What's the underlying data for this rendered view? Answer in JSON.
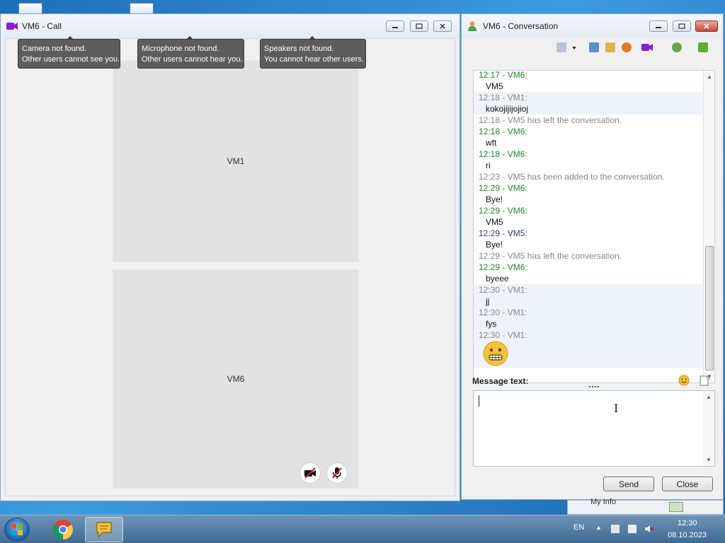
{
  "call_window": {
    "title": "VM6 - Call",
    "tooltips": [
      {
        "line1": "Camera not found.",
        "line2": "Other users cannot see you."
      },
      {
        "line1": "Microphone not found.",
        "line2": "Other users cannot hear you."
      },
      {
        "line1": "Speakers not found.",
        "line2": "You cannot hear other users."
      }
    ],
    "video_remote_label": "VM1",
    "video_local_label": "VM6"
  },
  "conversation_window": {
    "title": "VM6 - Conversation",
    "messages": [
      {
        "meta": "12:17 - VM6:",
        "text": "VM5"
      },
      {
        "meta": "12:18 - VM1:",
        "text": "kokojijijojioj"
      },
      {
        "meta": "12:18 - VM5 has left the conversation.",
        "text": ""
      },
      {
        "meta": "12:18 - VM6:",
        "text": "wft"
      },
      {
        "meta": "12:18 - VM6:",
        "text": "ri"
      },
      {
        "meta": "12:23 - VM5 has been added to the conversation.",
        "text": ""
      },
      {
        "meta": "12:29 - VM6:",
        "text": "Bye!"
      },
      {
        "meta": "12:29 - VM6:",
        "text": "VM5"
      },
      {
        "meta": "12:29 - VM5:",
        "text": "Bye!"
      },
      {
        "meta": "12:29 - VM5 has left the conversation.",
        "text": ""
      },
      {
        "meta": "12:29 - VM6:",
        "text": "byeee"
      },
      {
        "meta": "12:30 - VM1:",
        "text": "jj"
      },
      {
        "meta": "12:30 - VM1:",
        "text": "fys"
      },
      {
        "meta": "12:30 - VM1:",
        "text": ""
      }
    ],
    "message_label": "Message text:",
    "send_label": "Send",
    "close_label": "Close"
  },
  "tray": {
    "language": "EN",
    "time": "12:30",
    "date": "08.10.2023",
    "my_info_label": "My Info"
  },
  "icons": [
    "camera-icon",
    "minimize-icon",
    "maximize-icon",
    "close-icon",
    "user-icon",
    "emoji-icon",
    "chrome-icon",
    "chat-app-icon",
    "start-orb-icon"
  ]
}
